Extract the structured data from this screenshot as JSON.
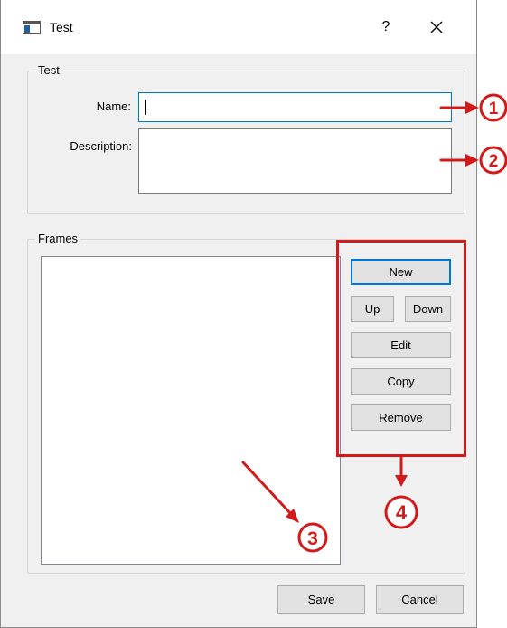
{
  "window": {
    "title": "Test",
    "help_label": "?",
    "icons": {
      "app": "window-icon",
      "close": "close-icon"
    }
  },
  "test_group": {
    "title": "Test",
    "name_label": "Name:",
    "name_value": "",
    "description_label": "Description:",
    "description_value": ""
  },
  "frames_group": {
    "title": "Frames",
    "list_items": [],
    "buttons": {
      "new": "New",
      "up": "Up",
      "down": "Down",
      "edit": "Edit",
      "copy": "Copy",
      "remove": "Remove"
    }
  },
  "footer": {
    "save": "Save",
    "cancel": "Cancel"
  },
  "annotations": {
    "callouts": [
      "1",
      "2",
      "3",
      "4"
    ],
    "color": "#d21a1a"
  }
}
